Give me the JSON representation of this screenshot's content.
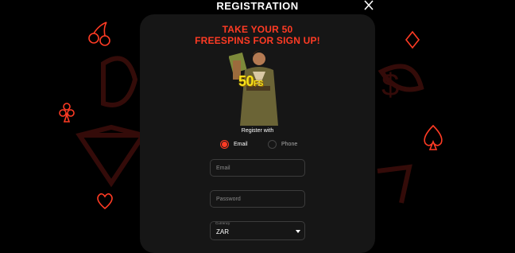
{
  "header": {
    "title": "REGISTRATION"
  },
  "promo": {
    "line1": "TAKE YOUR 50",
    "line2": "FREESPINS FOR SIGN UP!"
  },
  "badge": {
    "number": "50",
    "suffix": "FS"
  },
  "register_with": {
    "label": "Register with",
    "options": [
      {
        "label": "Email",
        "selected": true
      },
      {
        "label": "Phone",
        "selected": false
      }
    ]
  },
  "form": {
    "email_placeholder": "Email",
    "password_placeholder": "Password",
    "currency_caption": "Currency",
    "currency_value": "ZAR"
  },
  "colors": {
    "accent": "#ff3b24",
    "panel": "#161616",
    "badge": "#f6e21b"
  },
  "icons": [
    "cherry-icon",
    "club-icon",
    "diamond-icon",
    "heart-icon",
    "spade-icon",
    "dollar-icon",
    "seven-icon",
    "close-icon",
    "chevron-down-icon"
  ]
}
